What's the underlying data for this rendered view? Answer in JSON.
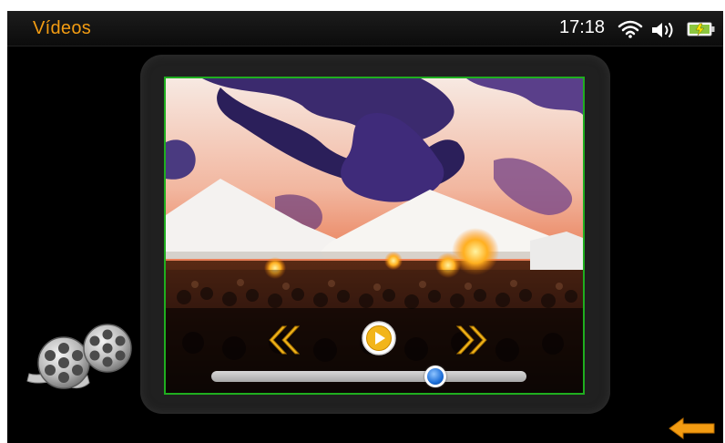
{
  "header": {
    "title": "Vídeos",
    "time": "17:18"
  },
  "icons": {
    "wifi": "wifi-icon",
    "volume": "speaker-volume-icon",
    "battery": "battery-charging-icon",
    "film": "film-reels-icon",
    "back": "back-arrow-icon",
    "rewind": "rewind-chevrons-icon",
    "play": "play-icon",
    "forward": "fast-forward-chevrons-icon"
  },
  "player": {
    "progress": 0.71
  },
  "colors": {
    "accent": "#f39c12",
    "frame_border": "#1fae1f",
    "slider_knob": "#2a7de0",
    "background": "#000000"
  }
}
